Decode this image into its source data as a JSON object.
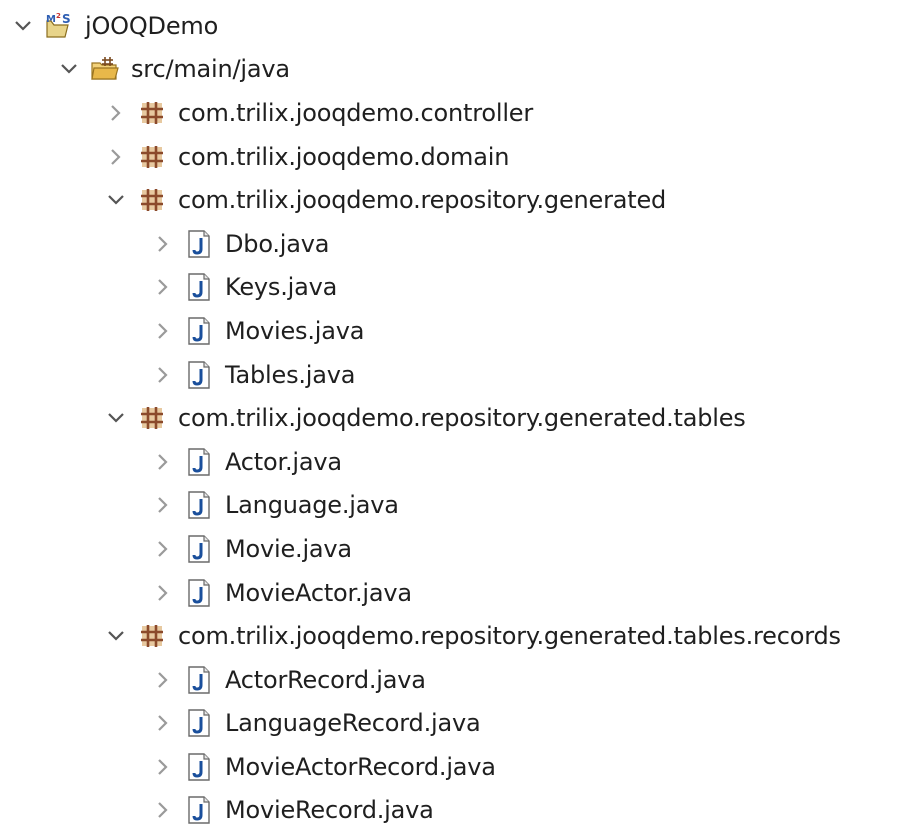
{
  "tree": {
    "project": {
      "label": "jOOQDemo",
      "icon": "maven-project-icon",
      "expanded": true
    },
    "source_folder": {
      "label": "src/main/java",
      "icon": "source-folder-icon",
      "expanded": true
    },
    "packages": [
      {
        "label": "com.trilix.jooqdemo.controller",
        "expanded": false,
        "files": []
      },
      {
        "label": "com.trilix.jooqdemo.domain",
        "expanded": false,
        "files": []
      },
      {
        "label": "com.trilix.jooqdemo.repository.generated",
        "expanded": true,
        "files": [
          "Dbo.java",
          "Keys.java",
          "Movies.java",
          "Tables.java"
        ]
      },
      {
        "label": "com.trilix.jooqdemo.repository.generated.tables",
        "expanded": true,
        "files": [
          "Actor.java",
          "Language.java",
          "Movie.java",
          "MovieActor.java"
        ]
      },
      {
        "label": "com.trilix.jooqdemo.repository.generated.tables.records",
        "expanded": true,
        "files": [
          "ActorRecord.java",
          "LanguageRecord.java",
          "MovieActorRecord.java",
          "MovieRecord.java"
        ]
      }
    ]
  },
  "colors": {
    "chevron": "#555555",
    "package_brown": "#8b4a2b",
    "package_fill": "#e7c9a0",
    "java_blue": "#1a4f9c",
    "folder_yellow": "#e8b84a",
    "maven_blue": "#2f5fb3",
    "maven_red": "#c8322f"
  }
}
